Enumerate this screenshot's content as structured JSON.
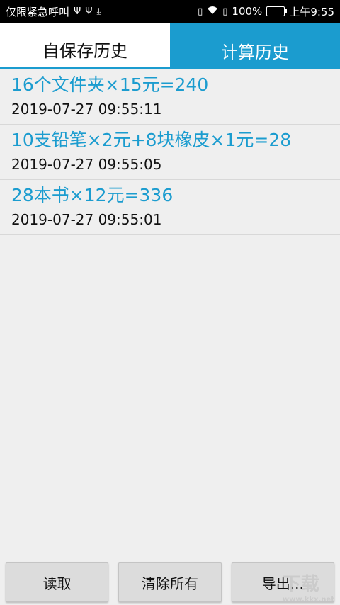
{
  "status_bar": {
    "left_text": "仅限紧急呼叫",
    "battery_percent": "100%",
    "time": "上午9:55"
  },
  "tabs": [
    {
      "label": "自保存历史"
    },
    {
      "label": "计算历史"
    }
  ],
  "history": [
    {
      "expression": "16个文件夹×15元=240",
      "timestamp": "2019-07-27 09:55:11"
    },
    {
      "expression": "10支铅笔×2元+8块橡皮×1元=28",
      "timestamp": "2019-07-27 09:55:05"
    },
    {
      "expression": "28本书×12元=336",
      "timestamp": "2019-07-27 09:55:01"
    }
  ],
  "buttons": {
    "read": "读取",
    "clear_all": "清除所有",
    "export": "导出..."
  },
  "watermark": {
    "text": "下载",
    "subtext": "www.kkx.net"
  },
  "colors": {
    "accent": "#1b9ccf",
    "background": "#efefef"
  }
}
